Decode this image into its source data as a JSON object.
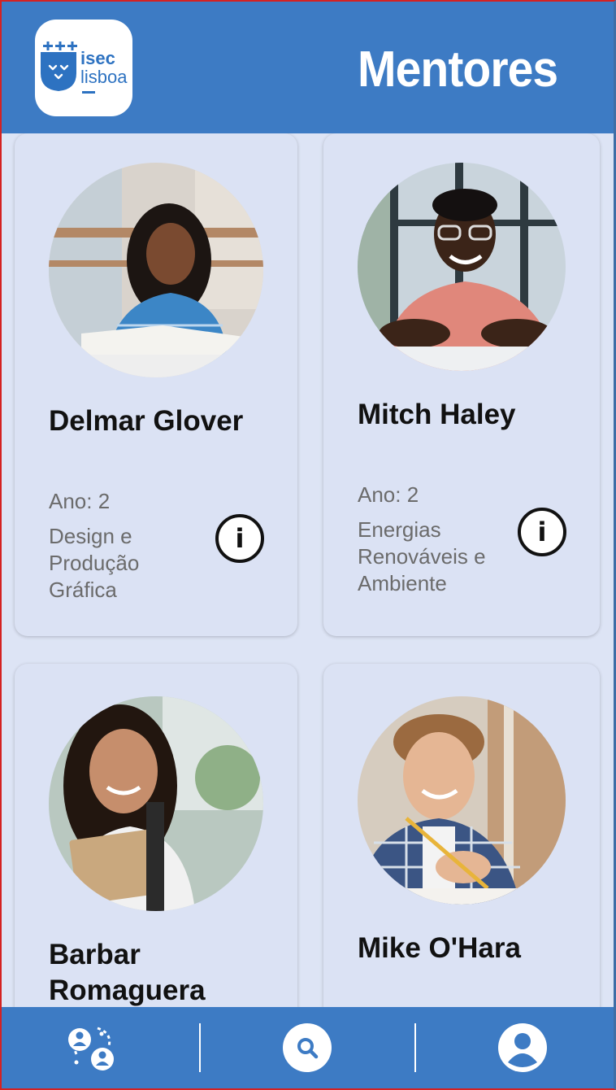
{
  "header": {
    "logo": {
      "line1": "isec",
      "line2": "lisboa",
      "mark": "+++"
    },
    "title": "Mentores"
  },
  "colors": {
    "primary": "#3d7bc4",
    "background": "#dde4f5",
    "card": "#dbe2f4",
    "muted_text": "#6b6b6b"
  },
  "mentors": [
    {
      "name": "Delmar Glover",
      "year": "Ano: 2",
      "course": "Design e Produção Gráfica"
    },
    {
      "name": "Mitch Haley",
      "year": "Ano: 2",
      "course": "Energias Renováveis e Ambiente"
    },
    {
      "name": "Barbar Romaguera"
    },
    {
      "name": "Mike O'Hara"
    }
  ],
  "navbar": {
    "items": [
      {
        "icon": "mentors-connect-icon"
      },
      {
        "icon": "search-icon"
      },
      {
        "icon": "profile-icon"
      }
    ]
  }
}
